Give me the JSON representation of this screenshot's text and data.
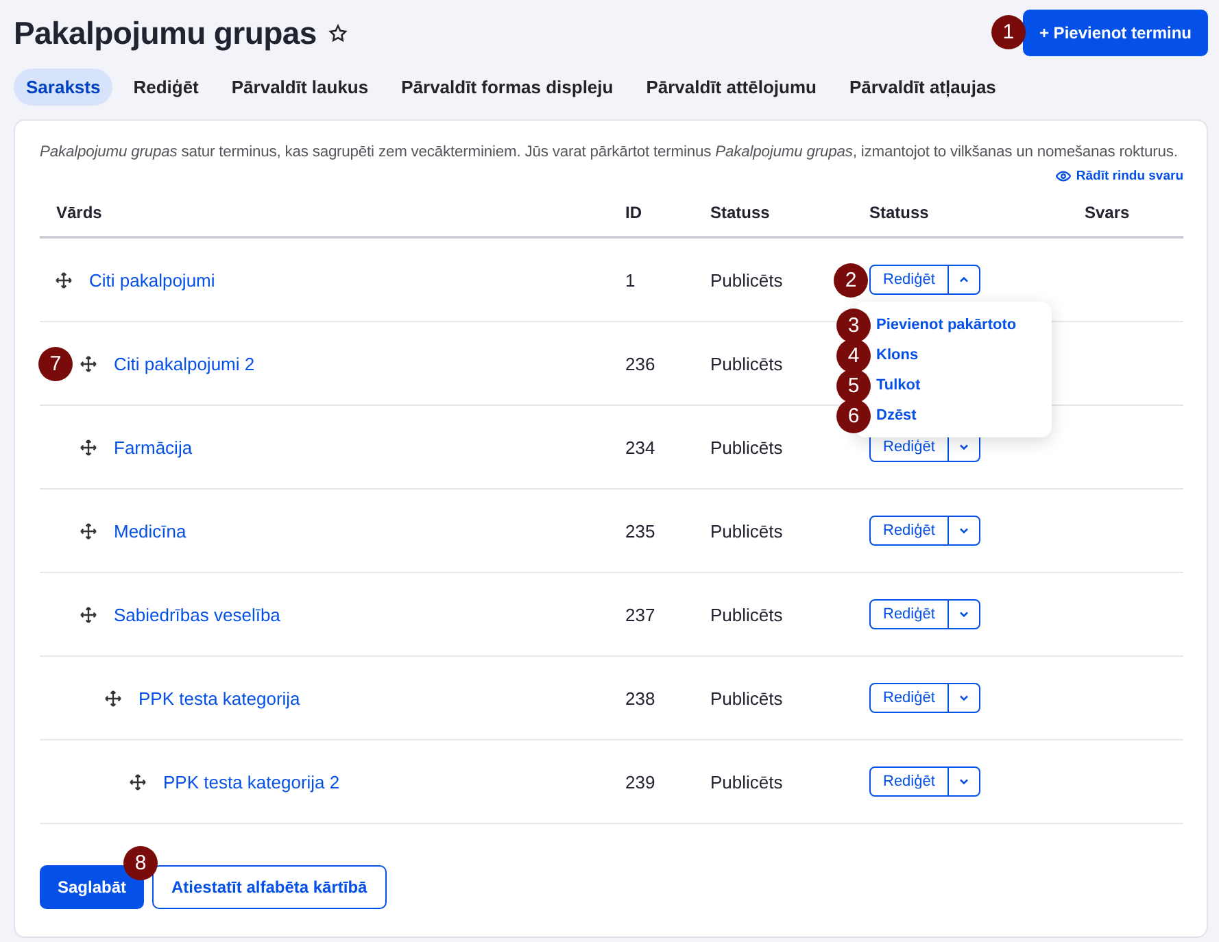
{
  "page": {
    "title": "Pakalpojumu grupas",
    "add_button": {
      "label": "+ Pievienot terminu",
      "callout": "1"
    }
  },
  "tabs": [
    {
      "label": "Saraksts",
      "selected": true
    },
    {
      "label": "Rediģēt",
      "selected": false
    },
    {
      "label": "Pārvaldīt laukus",
      "selected": false
    },
    {
      "label": "Pārvaldīt formas displeju",
      "selected": false
    },
    {
      "label": "Pārvaldīt attēlojumu",
      "selected": false
    },
    {
      "label": "Pārvaldīt atļaujas",
      "selected": false
    }
  ],
  "description": "*Pakalpojumu grupas* satur terminus, kas sagrupēti zem vecākterminiem. Jūs varat pārkārtot terminus *Pakalpojumu grupas*, izmantojot to vilkšanas un nomešanas rokturus.",
  "show_weights_link": "Rādīt rindu svaru",
  "table": {
    "columns": [
      "Vārds",
      "ID",
      "Statuss",
      "Statuss",
      "Svars"
    ],
    "rows": [
      {
        "name": "Citi pakalpojumi",
        "id": "1",
        "status": "Publicēts",
        "edit": "Rediģēt",
        "expanded": true,
        "callout": "2",
        "menu": [
          {
            "label": "Pievienot pakārtoto",
            "callout": "3"
          },
          {
            "label": "Klons",
            "callout": "4"
          },
          {
            "label": "Tulkot",
            "callout": "5"
          },
          {
            "label": "Dzēst",
            "callout": "6"
          }
        ],
        "children": [
          {
            "name": "Citi pakalpojumi 2",
            "id": "236",
            "status": "Publicēts",
            "drag_callout": "7"
          },
          {
            "name": "Farmācija",
            "id": "234",
            "status": "Publicēts",
            "edit": "Rediģēt",
            "expanded": false
          },
          {
            "name": "Medicīna",
            "id": "235",
            "status": "Publicēts",
            "edit": "Rediģēt",
            "expanded": false
          },
          {
            "name": "Sabiedrības veselība",
            "id": "237",
            "status": "Publicēts",
            "edit": "Rediģēt",
            "expanded": false,
            "children": [
              {
                "name": "PPK testa kategorija",
                "id": "238",
                "status": "Publicēts",
                "edit": "Rediģēt",
                "expanded": false,
                "children": [
                  {
                    "name": "PPK testa kategorija 2",
                    "id": "239",
                    "status": "Publicēts",
                    "edit": "Rediģēt",
                    "expanded": false
                  }
                ]
              }
            ]
          }
        ]
      }
    ]
  },
  "footer": {
    "save_button": {
      "label": "Saglabāt",
      "callout": "8"
    },
    "reset_button": "Atiestatīt alfabēta kārtībā"
  }
}
